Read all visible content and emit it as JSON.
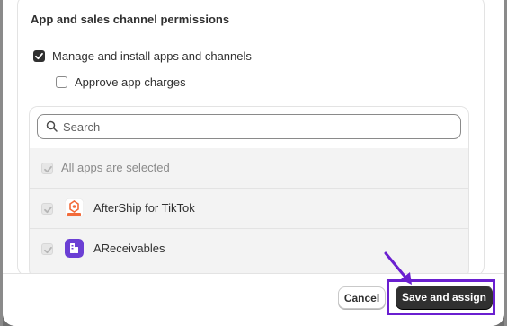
{
  "section": {
    "title": "App and sales channel permissions"
  },
  "options": {
    "manage_label": "Manage and install apps and channels",
    "manage_checked": true,
    "approve_label": "Approve app charges",
    "approve_checked": false
  },
  "search": {
    "placeholder": "Search",
    "value": ""
  },
  "apps": {
    "all_label": "All apps are selected",
    "items": [
      {
        "name": "AfterShip for TikTok",
        "icon": "aftership-icon",
        "checked": true
      },
      {
        "name": "AReceivables",
        "icon": "areceivables-icon",
        "checked": true
      }
    ]
  },
  "footer": {
    "cancel_label": "Cancel",
    "save_label": "Save and assign"
  },
  "colors": {
    "highlight": "#6a1fd0",
    "primary_button": "#303030"
  }
}
